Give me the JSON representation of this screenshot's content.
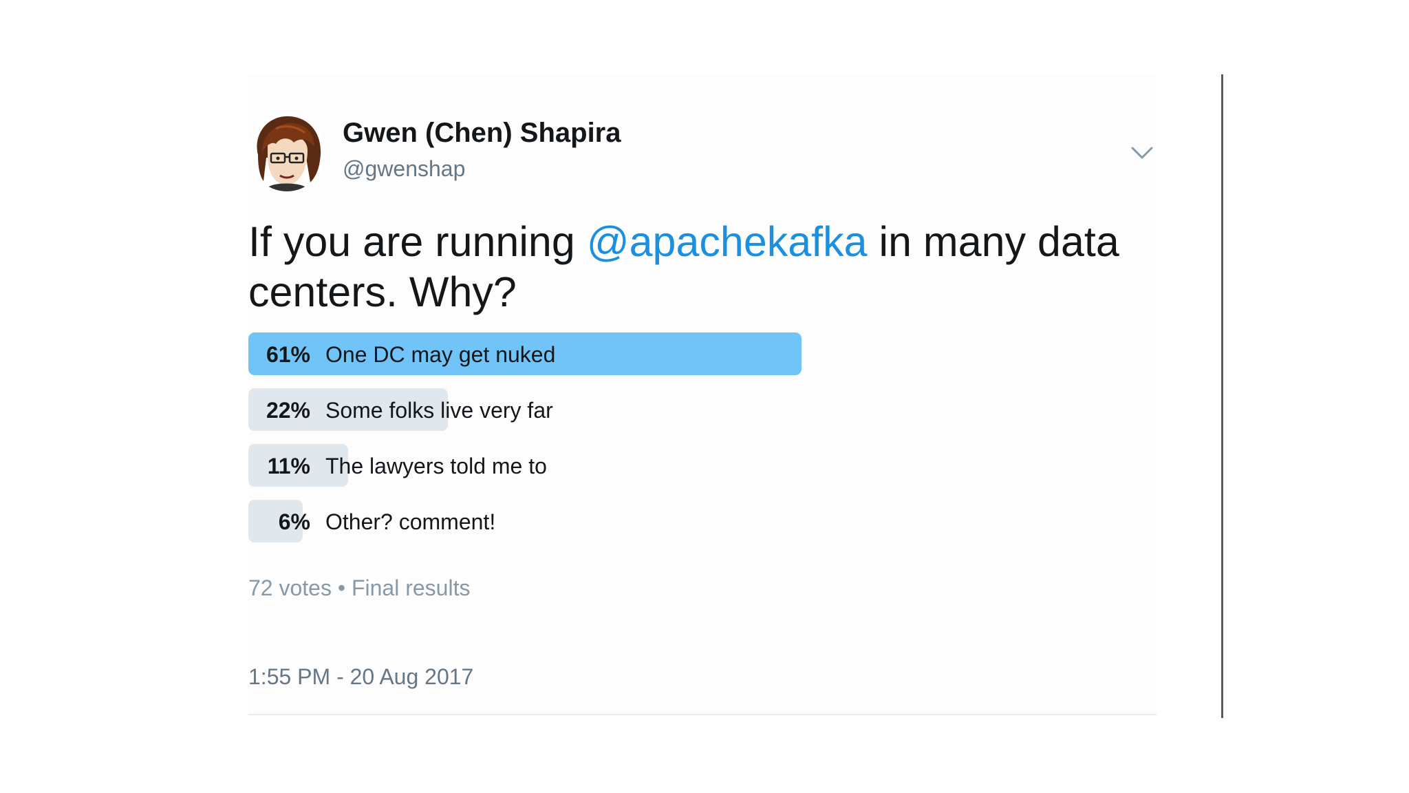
{
  "tweet": {
    "author_name": "Gwen (Chen) Shapira",
    "author_handle": "@gwenshap",
    "text_before": "If you are running ",
    "mention": "@apachekafka",
    "text_after": " in many data centers. Why?",
    "timestamp": "1:55 PM - 20 Aug 2017",
    "menu_icon": "chevron-down-icon",
    "avatar_icon": "cartoon-avatar"
  },
  "poll": {
    "options": [
      {
        "percent_label": "61%",
        "label": "One DC may get nuked",
        "share": 0.61,
        "winner": true
      },
      {
        "percent_label": "22%",
        "label": "Some folks live very far",
        "share": 0.22,
        "winner": false
      },
      {
        "percent_label": "11%",
        "label": "The lawyers told me to",
        "share": 0.11,
        "winner": false
      },
      {
        "percent_label": "6%",
        "label": "Other? comment!",
        "share": 0.06,
        "winner": false
      }
    ],
    "votes": "72 votes",
    "separator": " • ",
    "status": "Final results"
  },
  "colors": {
    "winner_bar": "#71c4f7",
    "other_bar": "#e1e8ed",
    "mention": "#1b8fe0",
    "secondary_text": "#657786"
  }
}
